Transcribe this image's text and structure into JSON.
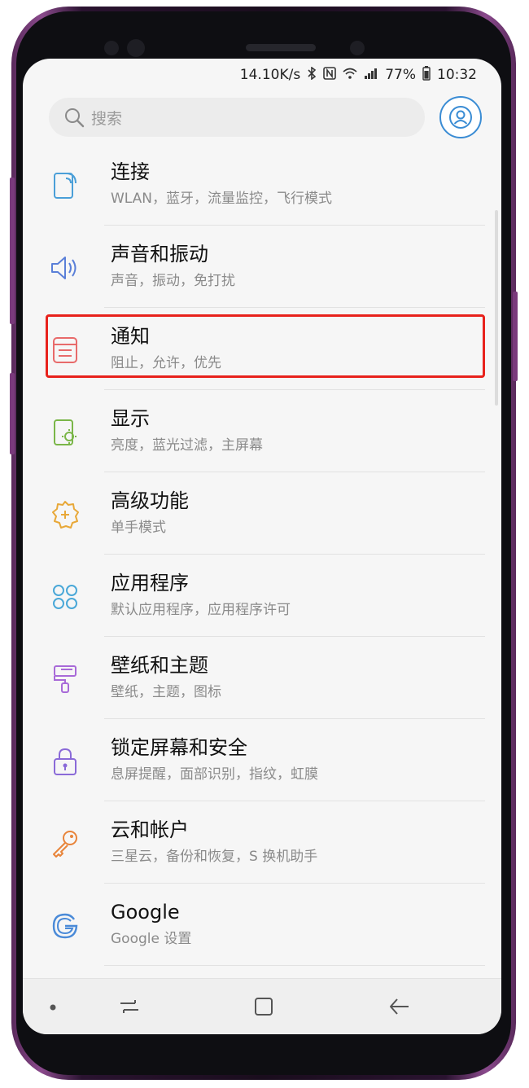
{
  "status_bar": {
    "network_speed": "14.10K/s",
    "battery": "77%",
    "time": "10:32",
    "icons": [
      "bluetooth-icon",
      "nfc-icon",
      "wifi-icon",
      "signal-icon",
      "battery-icon"
    ]
  },
  "search": {
    "placeholder": "搜索"
  },
  "settings": [
    {
      "title": "连接",
      "subtitle": "WLAN，蓝牙，流量监控，飞行模式",
      "icon": "connections-icon",
      "color": "#4a9fd8"
    },
    {
      "title": "声音和振动",
      "subtitle": "声音，振动，免打扰",
      "icon": "speaker-icon",
      "color": "#5a7fd8"
    },
    {
      "title": "通知",
      "subtitle": "阻止，允许，优先",
      "icon": "notification-icon",
      "color": "#e86a6a",
      "highlighted": true
    },
    {
      "title": "显示",
      "subtitle": "亮度，蓝光过滤，主屏幕",
      "icon": "display-icon",
      "color": "#7ab648"
    },
    {
      "title": "高级功能",
      "subtitle": "单手模式",
      "icon": "gear-plus-icon",
      "color": "#e8a838"
    },
    {
      "title": "应用程序",
      "subtitle": "默认应用程序，应用程序许可",
      "icon": "apps-icon",
      "color": "#4aa8d8"
    },
    {
      "title": "壁纸和主题",
      "subtitle": "壁纸，主题，图标",
      "icon": "paintbrush-icon",
      "color": "#a86ad8"
    },
    {
      "title": "锁定屏幕和安全",
      "subtitle": "息屏提醒，面部识别，指纹，虹膜",
      "icon": "lock-icon",
      "color": "#8a6ad8"
    },
    {
      "title": "云和帐户",
      "subtitle": "三星云，备份和恢复，S 换机助手",
      "icon": "key-icon",
      "color": "#e8843a"
    },
    {
      "title": "Google",
      "subtitle": "Google 设置",
      "icon": "google-icon",
      "color": "#4a8ad8"
    }
  ],
  "nav_bar": [
    "recents-icon",
    "home-icon",
    "back-icon"
  ],
  "colors": {
    "highlight_frame": "#e8221c",
    "accent": "#3a8cd4",
    "phone_frame": "#7a3a7c"
  }
}
